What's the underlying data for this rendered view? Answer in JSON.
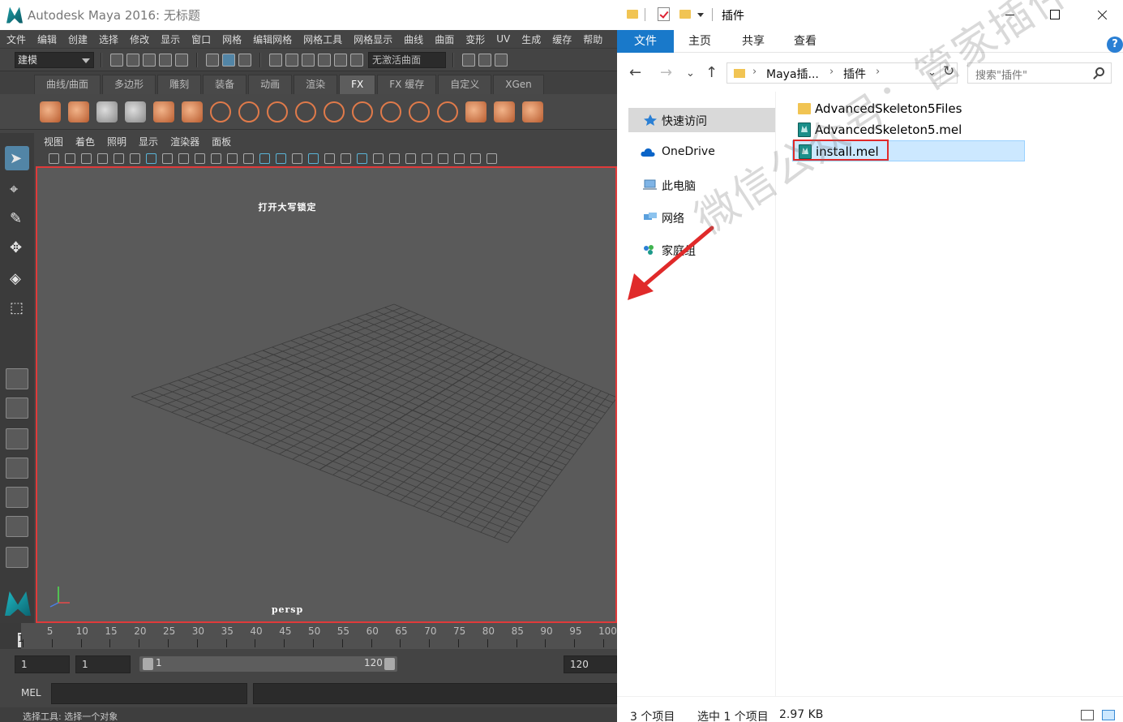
{
  "maya": {
    "title": "Autodesk Maya 2016: 无标题",
    "menu": [
      "文件",
      "编辑",
      "创建",
      "选择",
      "修改",
      "显示",
      "窗口",
      "网格",
      "编辑网格",
      "网格工具",
      "网格显示",
      "曲线",
      "曲面",
      "变形",
      "UV",
      "生成",
      "缓存",
      "帮助"
    ],
    "mode_select": "建模",
    "live_surface": "无激活曲面",
    "shelf_tabs": [
      "曲线/曲面",
      "多边形",
      "雕刻",
      "装备",
      "动画",
      "渲染",
      "FX",
      "FX 缓存",
      "自定义",
      "XGen"
    ],
    "active_shelf_tab": "FX",
    "viewport_menu": [
      "视图",
      "着色",
      "照明",
      "显示",
      "渲染器",
      "面板"
    ],
    "viewport_hud_top": "打开大写锁定",
    "viewport_camera": "persp",
    "timeline_ticks": [
      "5",
      "10",
      "15",
      "20",
      "25",
      "30",
      "35",
      "40",
      "45",
      "50",
      "55",
      "60",
      "65",
      "70",
      "75",
      "80",
      "85",
      "90",
      "95",
      "100"
    ],
    "current_frame": "1",
    "range": {
      "start": "1",
      "playback_start": "1",
      "bar_start": "1",
      "bar_end": "120",
      "end": "120"
    },
    "cmd_label": "MEL",
    "help_line": "选择工具: 选择一个对象"
  },
  "explorer": {
    "title": "插件",
    "ribbon": [
      "文件",
      "主页",
      "共享",
      "查看"
    ],
    "address": {
      "parts": [
        "Maya插...",
        "插件"
      ]
    },
    "search_placeholder": "搜索\"插件\"",
    "help": "?",
    "sidebar": [
      {
        "label": "快速访问",
        "icon": "star-icon"
      },
      {
        "label": "OneDrive",
        "icon": "cloud-icon"
      },
      {
        "label": "此电脑",
        "icon": "computer-icon"
      },
      {
        "label": "网络",
        "icon": "network-icon"
      },
      {
        "label": "家庭组",
        "icon": "homegroup-icon"
      }
    ],
    "files": [
      {
        "name": "AdvancedSkeleton5Files",
        "type": "folder"
      },
      {
        "name": "AdvancedSkeleton5.mel",
        "type": "mel"
      },
      {
        "name": "install.mel",
        "type": "mel",
        "selected": true
      }
    ],
    "status": {
      "count": "3 个项目",
      "selection": "选中 1 个项目",
      "size": "2.97 KB"
    }
  },
  "watermark": "微信公众号：管家插件",
  "colors": {
    "highlight": "#e03a3a",
    "accent": "#1979ca",
    "maya_bg": "#444444"
  }
}
